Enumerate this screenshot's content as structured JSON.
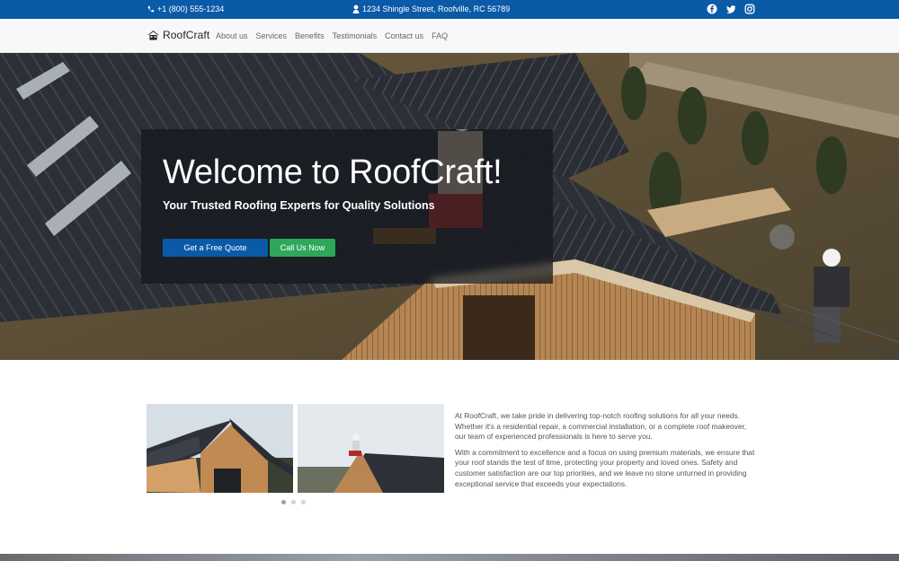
{
  "topbar": {
    "phone": "+1 (800) 555-1234",
    "address": "1234 Shingle Street, Roofville, RC 56789",
    "social": [
      "facebook-icon",
      "twitter-icon",
      "instagram-icon"
    ]
  },
  "nav": {
    "brand": "RoofCraft",
    "items": [
      "About us",
      "Services",
      "Benefits",
      "Testimonials",
      "Contact us",
      "FAQ"
    ]
  },
  "hero": {
    "title": "Welcome to RoofCraft!",
    "subtitle": "Your Trusted Roofing Experts for Quality Solutions",
    "primary_button": "Get a Free Quote",
    "secondary_button": "Call Us Now"
  },
  "about": {
    "paragraphs": [
      "At RoofCraft, we take pride in delivering top-notch roofing solutions for all your needs. Whether it's a residential repair, a commercial installation, or a complete roof makeover, our team of experienced professionals is here to serve you.",
      "With a commitment to excellence and a focus on using premium materials, we ensure that your roof stands the test of time, protecting your property and loved ones. Safety and customer satisfaction are our top priorities, and we leave no stone unturned in providing exceptional service that exceeds your expectations."
    ],
    "carousel_active_index": 0,
    "carousel_count": 3
  },
  "colors": {
    "primary": "#0a5aa8",
    "success": "#2fa75b",
    "topbar": "#0a5aa8"
  }
}
